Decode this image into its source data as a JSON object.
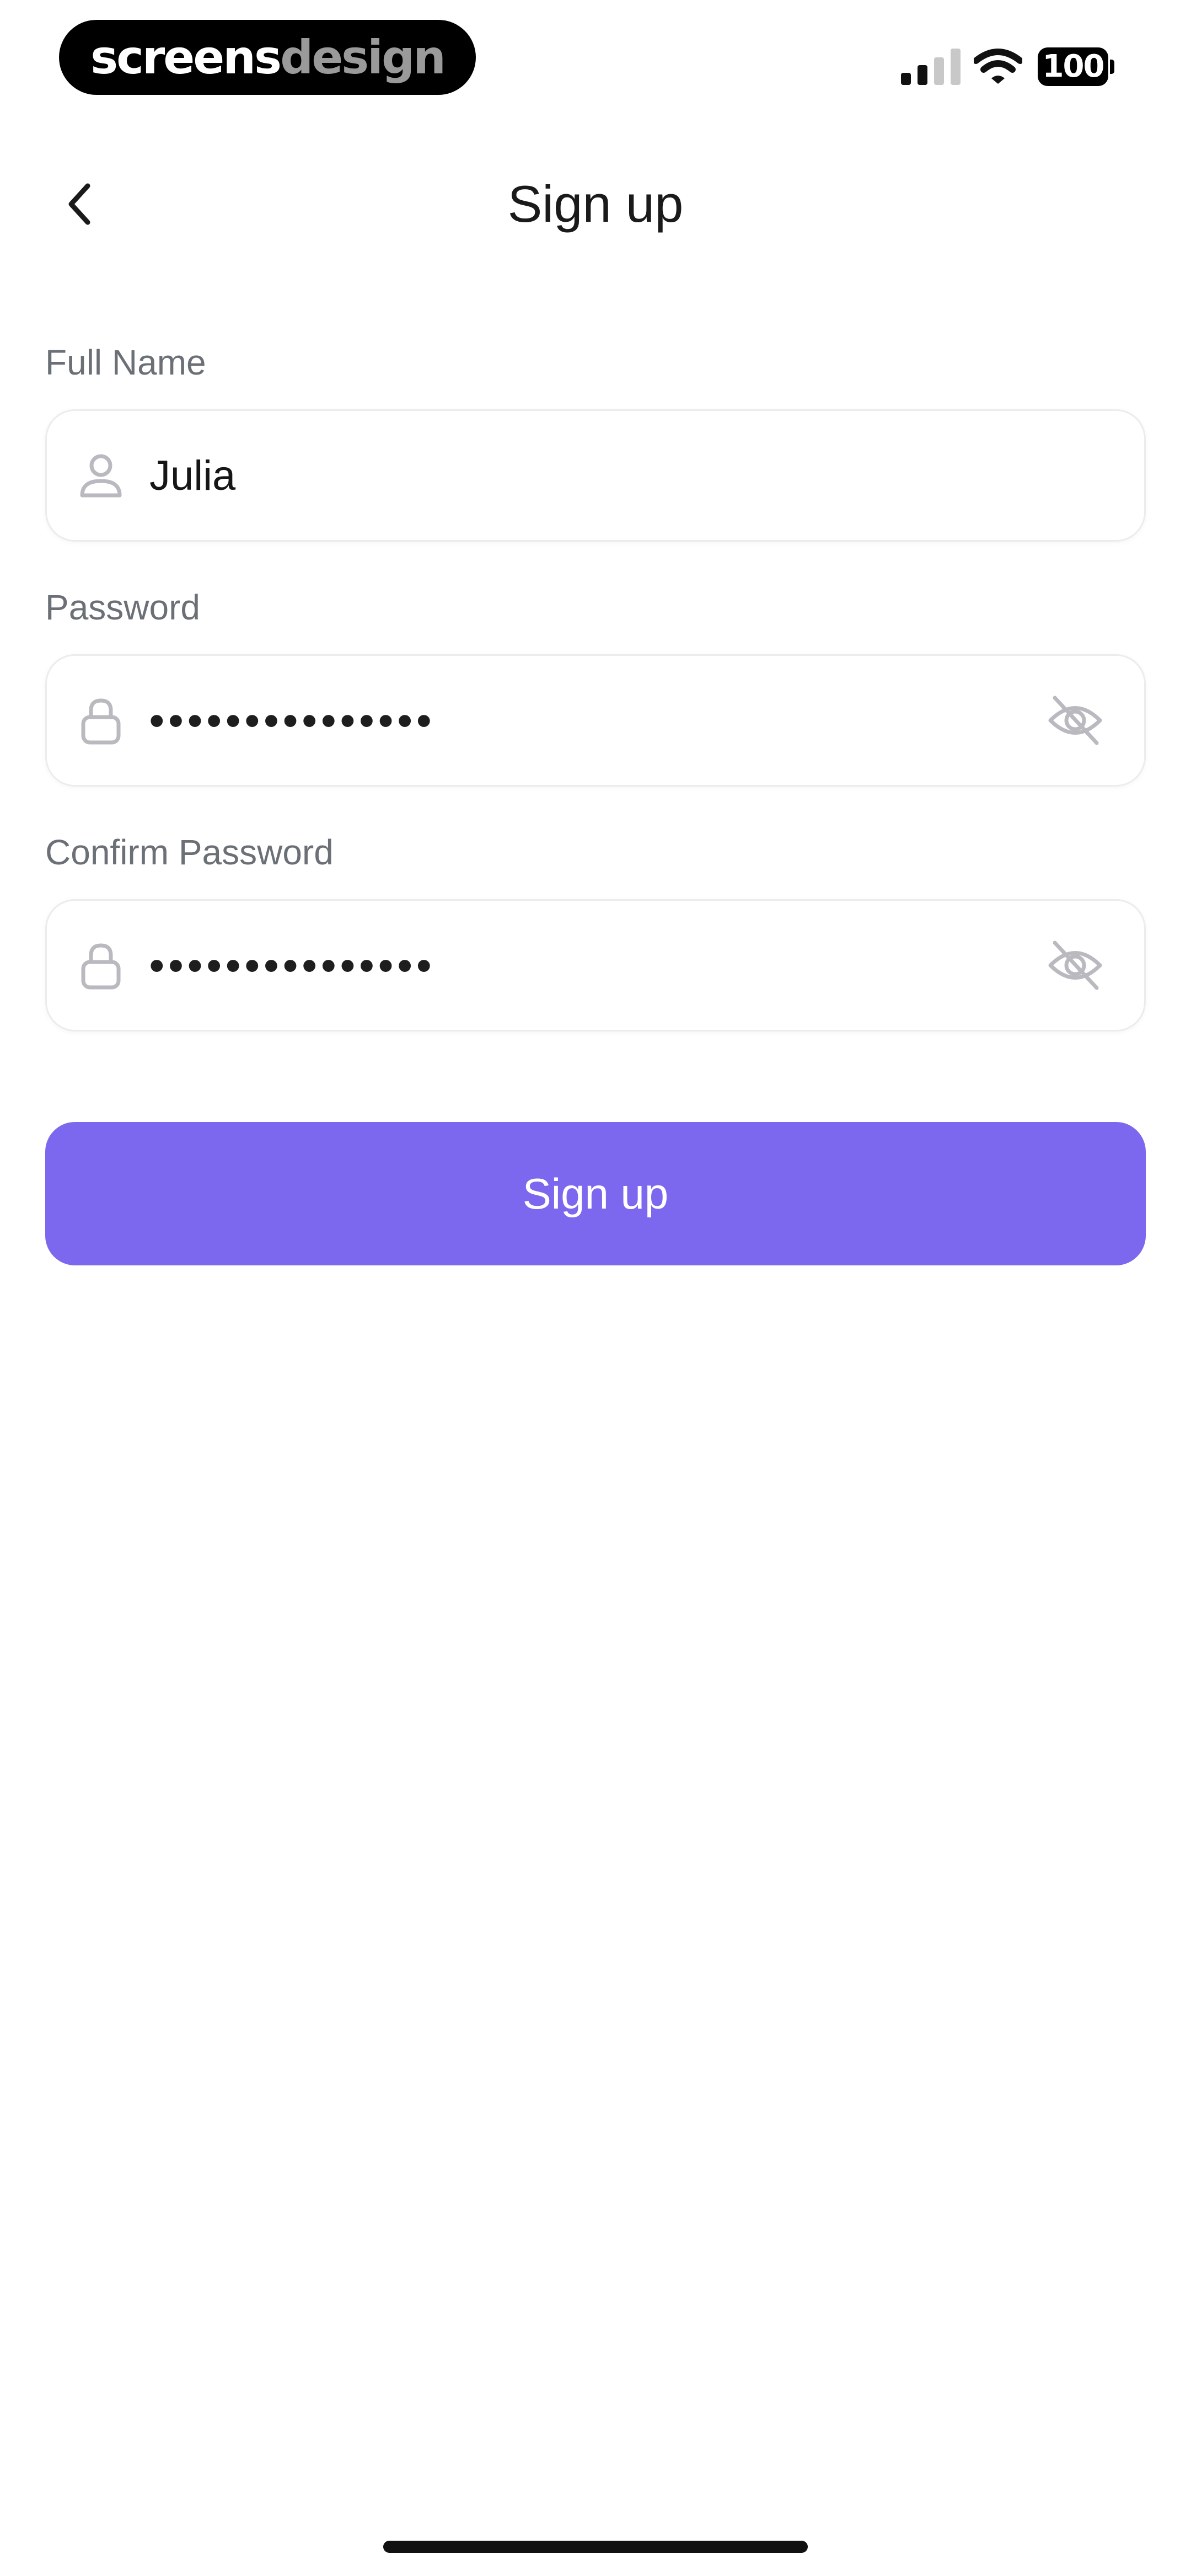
{
  "status_bar": {
    "brand_part1": "screens",
    "brand_part2": "design",
    "battery_level": "100",
    "signal_bars_active": 2,
    "signal_bars_total": 4
  },
  "header": {
    "title": "Sign up",
    "back_icon": "chevron-left-icon"
  },
  "form": {
    "full_name": {
      "label": "Full Name",
      "value": "Julia",
      "icon": "user-icon"
    },
    "password": {
      "label": "Password",
      "value": "•••••••••••••••",
      "icon": "lock-icon",
      "toggle_icon": "eye-off-icon"
    },
    "confirm_password": {
      "label": "Confirm Password",
      "value": "•••••••••••••••",
      "icon": "lock-icon",
      "toggle_icon": "eye-off-icon"
    },
    "submit_label": "Sign up"
  },
  "colors": {
    "accent": "#7B68EE",
    "label_text": "#6B6F76",
    "input_border": "#ECECEF",
    "icon_gray": "#B9B9BF"
  }
}
